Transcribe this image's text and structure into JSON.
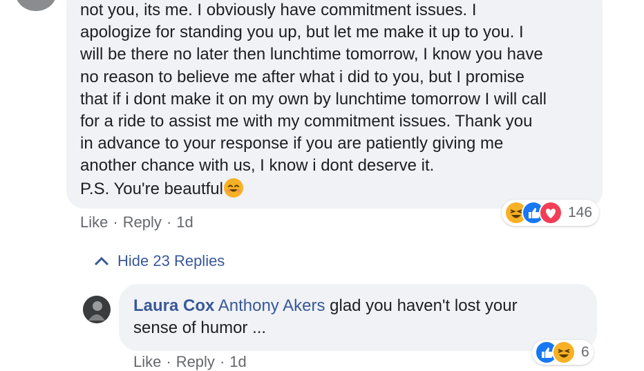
{
  "main_comment": {
    "lines": [
      "not you, its me. I obviously have commitment issues. I",
      "apologize for standing you up, but let me make it up to you. I",
      "will be there no later then lunchtime tomorrow, I know you have",
      "no reason to believe me after what i did to you, but I promise",
      "that if i dont make it on my own by lunchtime tomorrow I will call",
      "for a ride to assist me with my commitment issues. Thank you",
      "in advance to your response if you are patiently giving me",
      "another chance with us, I know i dont deserve it."
    ],
    "ps_text": "P.S. You're beautful",
    "reactions": {
      "icons": [
        "haha-icon",
        "like-icon",
        "love-icon"
      ],
      "count": "146"
    },
    "actions": {
      "like": "Like",
      "reply": "Reply",
      "time": "1d",
      "separator": "·"
    }
  },
  "hide_replies": {
    "label": "Hide 23 Replies",
    "icon": "chevron-up-icon"
  },
  "reply": {
    "author": "Laura Cox",
    "mention": "Anthony Akers",
    "text_line1": "glad you haven't lost your",
    "text_line2": "sense of humor ...",
    "reactions": {
      "icons": [
        "like-icon",
        "haha-icon"
      ],
      "count": "6"
    },
    "actions": {
      "like": "Like",
      "reply": "Reply",
      "time": "1d",
      "separator": "·"
    }
  },
  "colors": {
    "bubble": "#f0f2f5",
    "link": "#385898",
    "meta": "#65676b",
    "like_blue": "#1877f2",
    "haha_yellow": "#f7b125",
    "love_red": "#f33e58"
  }
}
